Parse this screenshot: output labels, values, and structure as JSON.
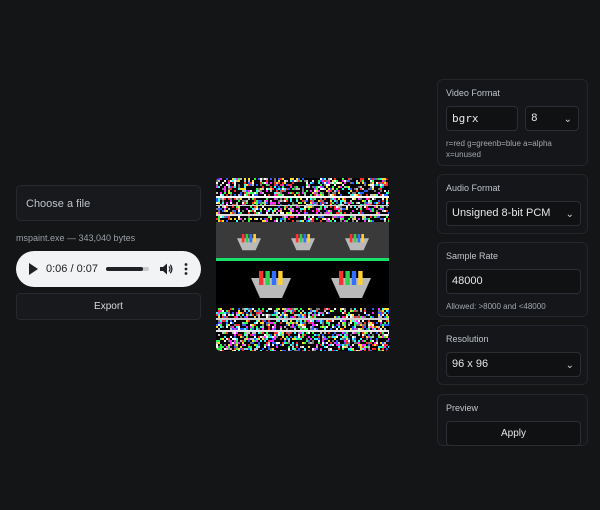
{
  "file": {
    "placeholder": "Choose a file",
    "info": "mspaint.exe — 343,040 bytes"
  },
  "player": {
    "current": "0:06",
    "duration": "0:07",
    "time_text": "0:06 / 0:07",
    "progress": 0.86
  },
  "export_label": "Export",
  "video_format": {
    "title": "Video Format",
    "pixel_format": "bgrx",
    "bits": "8",
    "help": "r=red g=greenb=blue a=alpha x=unused"
  },
  "audio_format": {
    "title": "Audio Format",
    "value": "Unsigned 8-bit PCM"
  },
  "sample_rate": {
    "title": "Sample Rate",
    "value": "48000",
    "help": "Allowed: >8000 and <48000"
  },
  "resolution": {
    "title": "Resolution",
    "value": "96 x 96"
  },
  "preview_panel": {
    "title": "Preview",
    "apply_label": "Apply"
  },
  "icons": {
    "play": "play-icon",
    "volume": "volume-icon",
    "more": "more-vert-icon",
    "chevron": "chevron-down-icon"
  }
}
